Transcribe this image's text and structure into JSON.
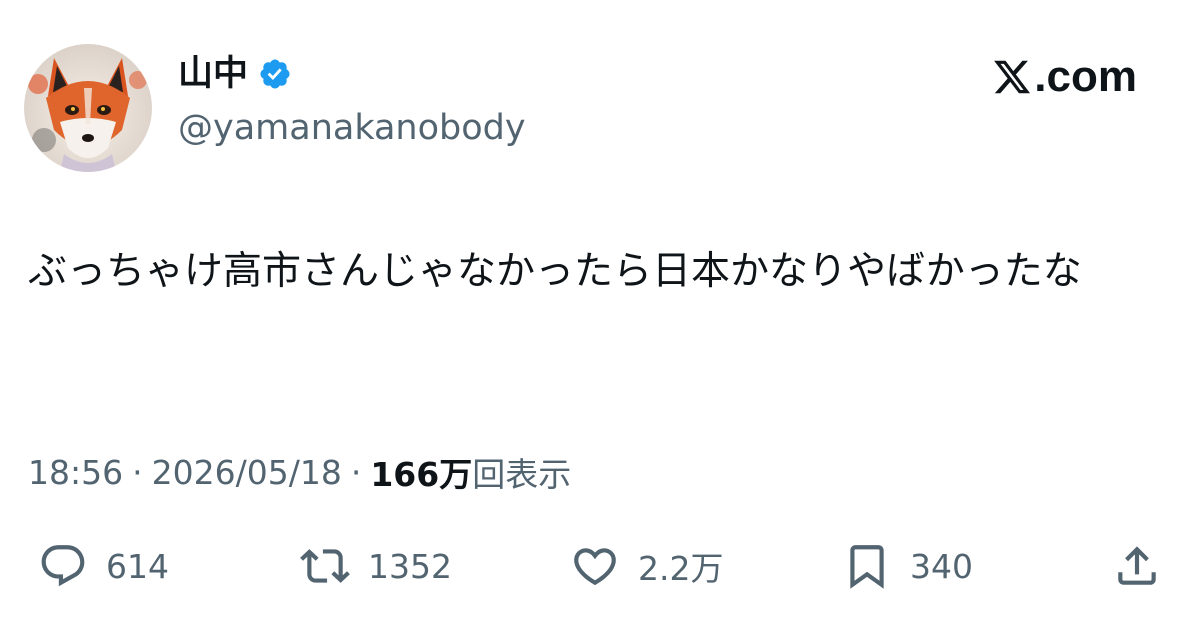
{
  "author": {
    "display_name": "山中",
    "handle": "@yamanakanobody",
    "verified": true,
    "avatar_icon": "fox-avatar"
  },
  "brand": {
    "label": ".com",
    "icon": "x-logo-icon"
  },
  "tweet": {
    "text": "ぶっちゃけ高市さんじゃなかったら日本かなりやばかったな"
  },
  "meta": {
    "time": "18:56",
    "separator": "·",
    "date": "2026/05/18",
    "views_count": "166万",
    "views_label": "回表示"
  },
  "actions": {
    "replies": "614",
    "retweets": "1352",
    "likes": "2.2万",
    "bookmarks": "340"
  },
  "colors": {
    "text": "#0f1419",
    "secondary": "#536471",
    "verified": "#1d9bf0"
  }
}
